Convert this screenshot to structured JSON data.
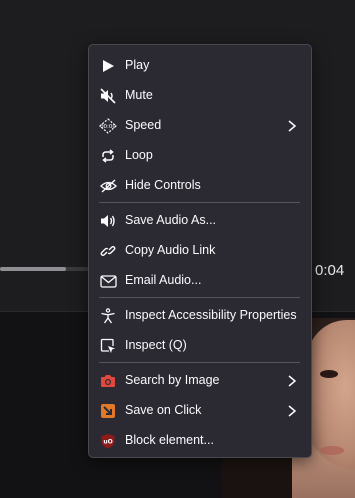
{
  "player": {
    "time_display": "0:04",
    "progress_fraction": 0.69
  },
  "menu": {
    "items": [
      {
        "label": "Play",
        "icon": "play-icon"
      },
      {
        "label": "Mute",
        "icon": "mute-icon"
      },
      {
        "label": "Speed",
        "icon": "speed-icon",
        "submenu": true
      },
      {
        "label": "Loop",
        "icon": "loop-icon"
      },
      {
        "label": "Hide Controls",
        "icon": "hide-controls-icon"
      },
      {
        "label": "Save Audio As...",
        "icon": "speaker-icon"
      },
      {
        "label": "Copy Audio Link",
        "icon": "link-icon"
      },
      {
        "label": "Email Audio...",
        "icon": "email-icon"
      },
      {
        "label": "Inspect Accessibility Properties",
        "icon": "accessibility-icon"
      },
      {
        "label": "Inspect (Q)",
        "icon": "inspect-icon"
      },
      {
        "label": "Search by Image",
        "icon": "camera-icon",
        "submenu": true
      },
      {
        "label": "Save on Click",
        "icon": "save-on-click-icon",
        "submenu": true
      },
      {
        "label": "Block element...",
        "icon": "ublock-icon"
      }
    ]
  },
  "colors": {
    "menu_bg": "#2b2a33",
    "menu_text": "#fbfbfe",
    "camera_accent": "#e0483e",
    "save_on_click_accent": "#e07a2a",
    "ublock_accent": "#8e1b1b"
  }
}
